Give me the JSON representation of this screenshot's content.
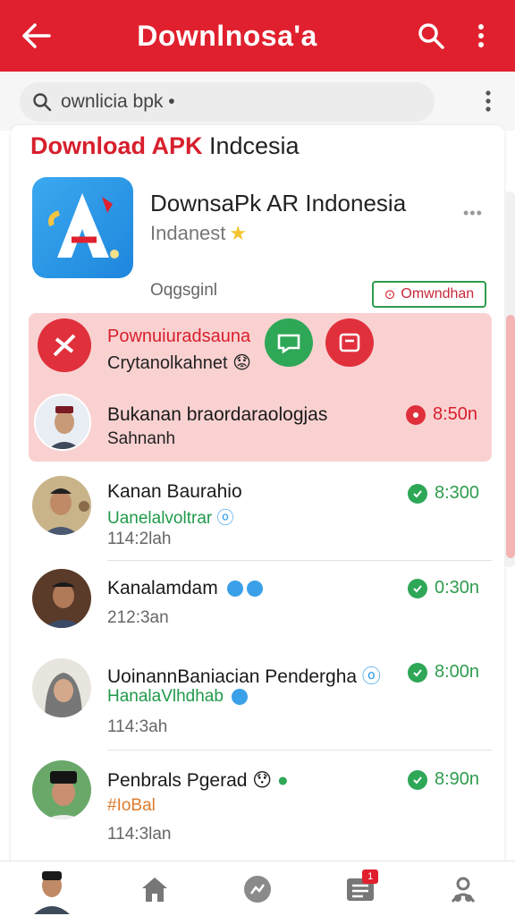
{
  "appbar": {
    "title": "Downlnosa'a",
    "back_icon": "back-arrow-icon",
    "search_icon": "search-icon",
    "more_icon": "more-vert-icon"
  },
  "search": {
    "value": "ownlicia bpk •"
  },
  "section": {
    "title_red": "Download APK",
    "title_black": " Indcesia"
  },
  "app": {
    "name": "DownsaPk AR Indonesia",
    "sub": "Indanest",
    "meta": "Oqgsginl",
    "download_label": "Omwndhan"
  },
  "highlight": {
    "title": "Pownuiuradsauna",
    "sub": "Crytanolkahnet",
    "row_title": "Bukanan braordaraologjas",
    "row_sub": "Sahnanh",
    "row_time": "8:50n"
  },
  "rows": [
    {
      "title": "Kanan Baurahio",
      "sub": "Uanelalvoltrar",
      "meta": "114:2lah",
      "time": "8:300",
      "sub_color": "#1f9a4a"
    },
    {
      "title": "Kanalamdam",
      "sub": "",
      "meta": "212:3an",
      "time": "0:30n",
      "sub_color": "#1f9a4a"
    },
    {
      "title": "UoinannBaniacian Pendergha",
      "sub": "HanalaVlhdhab",
      "meta": "114:3ah",
      "time": "8:00n",
      "sub_color": "#1f9a4a"
    },
    {
      "title": "Penbrals Pgerad",
      "sub": "#IoBal",
      "meta": "114:3lan",
      "time": "8:90n",
      "sub_color": "#e07a2a"
    }
  ],
  "nav": {
    "badge": "1"
  },
  "colors": {
    "brand": "#e0202e",
    "green": "#2e9c4d",
    "highlight": "#fad1d1"
  }
}
